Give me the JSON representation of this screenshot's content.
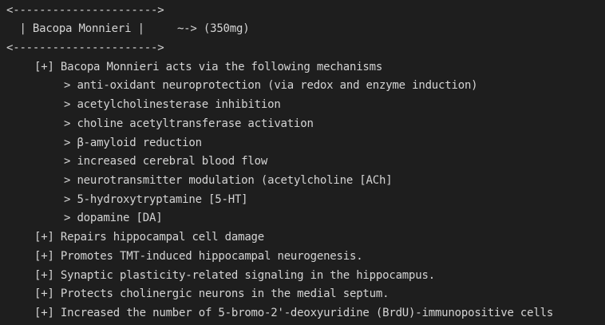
{
  "header": {
    "border_top": "<---------------------->",
    "title_line": "  | Bacopa Monnieri |     ~-> (350mg)",
    "border_bottom": "<---------------------->"
  },
  "mechanisms": {
    "heading": "[+] Bacopa Monnieri acts via the following mechanisms",
    "items": [
      "> anti-oxidant neuroprotection (via redox and enzyme induction)",
      "> acetylcholinesterase inhibition",
      "> choline acetyltransferase activation",
      "> β-amyloid reduction",
      "> increased cerebral blood flow",
      "> neurotransmitter modulation (acetylcholine [ACh]",
      "> 5-hydroxytryptamine [5-HT]",
      "> dopamine [DA]"
    ]
  },
  "effects": [
    "[+] Repairs hippocampal cell damage",
    "[+] Promotes TMT-induced hippocampal neurogenesis.",
    "[+] Synaptic plasticity-related signaling in the hippocampus.",
    "[+] Protects cholinergic neurons in the medial septum.",
    "[+] Increased the number of 5-bromo-2'-deoxyuridine (BrdU)-immunopositive cells"
  ]
}
